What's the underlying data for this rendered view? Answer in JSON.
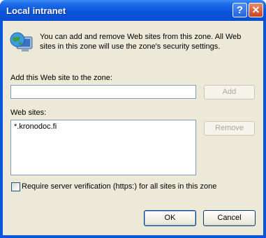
{
  "window": {
    "title": "Local intranet"
  },
  "titlebar": {
    "help_glyph": "?",
    "close_glyph": "✕"
  },
  "intro": {
    "text": "You can add and remove Web sites from this zone. All Web sites in this zone will use the zone's security settings."
  },
  "add_section": {
    "label": "Add this Web site to the zone:",
    "input_value": "",
    "add_button": "Add"
  },
  "sites_section": {
    "label": "Web sites:",
    "sites": [
      "*.kronodoc.fi"
    ],
    "remove_button": "Remove"
  },
  "verification": {
    "label": "Require server verification (https:) for all sites in this zone",
    "checked": false
  },
  "footer": {
    "ok_button": "OK",
    "cancel_button": "Cancel"
  },
  "icons": [
    "globe-computer-icon",
    "help-icon",
    "close-icon"
  ],
  "colors": {
    "title_bar": "#0a55dc",
    "dialog_bg": "#ece9d8",
    "input_border": "#7f9db9"
  }
}
